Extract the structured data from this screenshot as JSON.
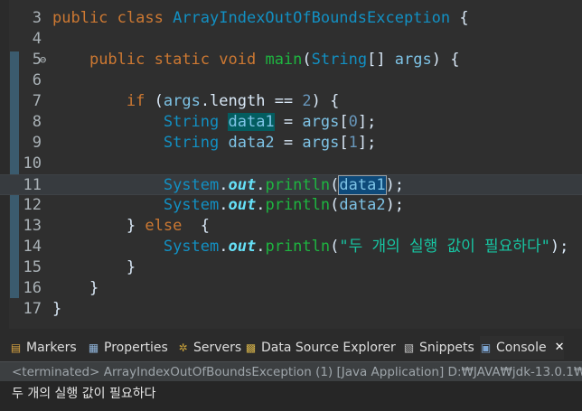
{
  "editor": {
    "lines": [
      {
        "n": "3",
        "parts": [
          [
            "kw",
            "public "
          ],
          [
            "kw",
            "class "
          ],
          [
            "cls",
            "ArrayIndexOutOfBoundsException"
          ],
          [
            "",
            " {"
          ]
        ]
      },
      {
        "n": "4",
        "parts": []
      },
      {
        "n": "5",
        "parts": [
          [
            "",
            "    "
          ],
          [
            "kw",
            "public "
          ],
          [
            "kw",
            "static "
          ],
          [
            "kw",
            "void "
          ],
          [
            "fn",
            "main"
          ],
          [
            "",
            "("
          ],
          [
            "cls",
            "String"
          ],
          [
            "",
            "[] "
          ],
          [
            "var2",
            "args"
          ],
          [
            "",
            ") {"
          ]
        ]
      },
      {
        "n": "6",
        "parts": []
      },
      {
        "n": "7",
        "parts": [
          [
            "",
            "        "
          ],
          [
            "kw",
            "if "
          ],
          [
            "",
            "("
          ],
          [
            "var2",
            "args"
          ],
          [
            "",
            ".length == "
          ],
          [
            "num",
            "2"
          ],
          [
            "",
            ") {"
          ]
        ]
      },
      {
        "n": "8",
        "parts": [
          [
            "",
            "            "
          ],
          [
            "cls",
            "String "
          ],
          [
            "hlw",
            "data1"
          ],
          [
            "",
            " = "
          ],
          [
            "var2",
            "args"
          ],
          [
            "",
            "["
          ],
          [
            "num",
            "0"
          ],
          [
            "",
            "];"
          ]
        ]
      },
      {
        "n": "9",
        "parts": [
          [
            "",
            "            "
          ],
          [
            "cls",
            "String "
          ],
          [
            "hlw2",
            "data2"
          ],
          [
            "",
            " = "
          ],
          [
            "var2",
            "args"
          ],
          [
            "",
            "["
          ],
          [
            "num",
            "1"
          ],
          [
            "",
            "];"
          ]
        ]
      },
      {
        "n": "10",
        "parts": []
      },
      {
        "n": "11",
        "parts": [
          [
            "",
            "            "
          ],
          [
            "cls",
            "System"
          ],
          [
            "",
            "."
          ],
          [
            "fld",
            "out"
          ],
          [
            "",
            "."
          ],
          [
            "fn",
            "println"
          ],
          [
            "",
            "("
          ],
          [
            "hl",
            "data1"
          ],
          [
            "",
            ");"
          ]
        ]
      },
      {
        "n": "12",
        "parts": [
          [
            "",
            "            "
          ],
          [
            "cls",
            "System"
          ],
          [
            "",
            "."
          ],
          [
            "fld",
            "out"
          ],
          [
            "",
            "."
          ],
          [
            "fn",
            "println"
          ],
          [
            "",
            "("
          ],
          [
            "plain",
            "data2"
          ],
          [
            "",
            ");"
          ]
        ]
      },
      {
        "n": "13",
        "parts": [
          [
            "",
            "        } "
          ],
          [
            "kw",
            "else "
          ],
          [
            "",
            " {"
          ]
        ]
      },
      {
        "n": "14",
        "parts": [
          [
            "",
            "            "
          ],
          [
            "cls",
            "System"
          ],
          [
            "",
            "."
          ],
          [
            "fld",
            "out"
          ],
          [
            "",
            "."
          ],
          [
            "fn",
            "println"
          ],
          [
            "",
            "("
          ],
          [
            "str",
            "\"두 개의 실행 값이 필요하다\""
          ],
          [
            "",
            ");"
          ]
        ]
      },
      {
        "n": "15",
        "parts": [
          [
            "",
            "        }"
          ]
        ]
      },
      {
        "n": "16",
        "parts": [
          [
            "",
            "    }"
          ]
        ]
      },
      {
        "n": "17",
        "parts": [
          [
            "",
            "}"
          ]
        ]
      }
    ],
    "fold_marker": "⊖"
  },
  "tabs": [
    {
      "name": "tab-markers",
      "label": "Markers",
      "icon": "markers-icon",
      "glyph": "▤",
      "color": "#d9a441"
    },
    {
      "name": "tab-properties",
      "label": "Properties",
      "icon": "properties-icon",
      "glyph": "▦",
      "color": "#8fb3d9"
    },
    {
      "name": "tab-servers",
      "label": "Servers",
      "icon": "servers-icon",
      "glyph": "✲",
      "color": "#c9a23a"
    },
    {
      "name": "tab-data-source-explorer",
      "label": "Data Source Explorer",
      "icon": "data-source-icon",
      "glyph": "▩",
      "color": "#d6b34a"
    },
    {
      "name": "tab-snippets",
      "label": "Snippets",
      "icon": "snippets-icon",
      "glyph": "▧",
      "color": "#c7c7c7"
    },
    {
      "name": "tab-console",
      "label": "Console",
      "icon": "console-icon",
      "glyph": "▣",
      "color": "#7fa7d4"
    }
  ],
  "close_glyph": "✕",
  "console": {
    "header": "<terminated> ArrayIndexOutOfBoundsException (1) [Java Application] D:₩JAVA₩jdk-13.0.1₩",
    "output": "두 개의 실행 값이 필요하다"
  },
  "colors": {
    "background": "#2f2f2f",
    "keyword": "#cc7832",
    "class": "#1290c3",
    "method": "#1eb540",
    "string": "#17c6a3"
  }
}
